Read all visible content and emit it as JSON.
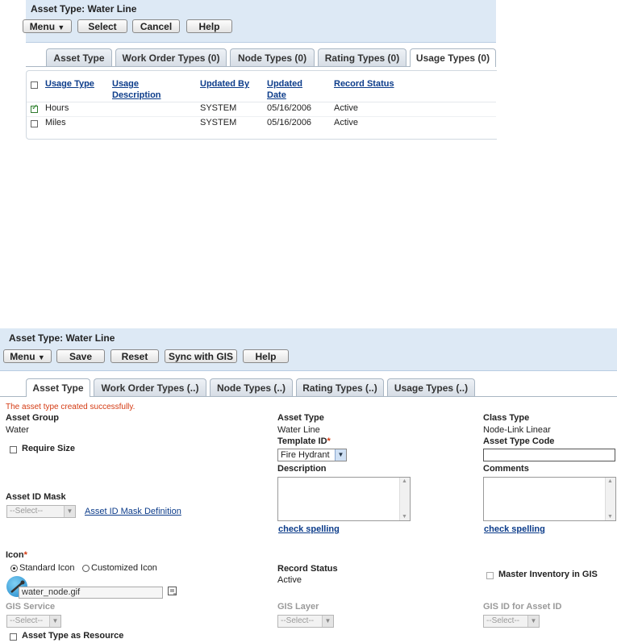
{
  "top": {
    "title": "Asset Type: Water Line",
    "buttons": {
      "menu": "Menu",
      "select": "Select",
      "cancel": "Cancel",
      "help": "Help"
    },
    "tabs": [
      "Asset Type",
      "Work Order Types (0)",
      "Node Types (0)",
      "Rating Types (0)",
      "Usage Types (0)"
    ],
    "active_tab": "Usage Types (0)",
    "table": {
      "headers": [
        "Usage Type",
        "Usage Description",
        "Updated By",
        "Updated Date",
        "Record Status"
      ],
      "header_lines": {
        "usage_desc_1": "Usage",
        "usage_desc_2": "Description",
        "updated_date_1": "Updated",
        "updated_date_2": "Date"
      },
      "rows": [
        {
          "usage_type": "Hours",
          "description": "",
          "updated_by": "SYSTEM",
          "updated_date": "05/16/2006",
          "status": "Active",
          "checked": true
        },
        {
          "usage_type": "Miles",
          "description": "",
          "updated_by": "SYSTEM",
          "updated_date": "05/16/2006",
          "status": "Active",
          "checked": false
        }
      ]
    }
  },
  "bottom": {
    "title": "Asset Type: Water Line",
    "buttons": {
      "menu": "Menu",
      "save": "Save",
      "reset": "Reset",
      "sync": "Sync with GIS",
      "help": "Help"
    },
    "tabs": [
      "Asset Type",
      "Work Order Types (..)",
      "Node Types (..)",
      "Rating Types (..)",
      "Usage Types (..)"
    ],
    "active_tab": "Asset Type",
    "message": "The asset type created successfully.",
    "fields": {
      "asset_group_label": "Asset Group",
      "asset_group_value": "Water",
      "asset_type_label": "Asset Type",
      "asset_type_value": "Water Line",
      "class_type_label": "Class Type",
      "class_type_value": "Node-Link Linear",
      "require_size_label": "Require Size",
      "template_id_label": "Template ID",
      "template_id_value": "Fire Hydrant",
      "asset_type_code_label": "Asset Type Code",
      "asset_type_code_value": "",
      "description_label": "Description",
      "comments_label": "Comments",
      "asset_id_mask_label": "Asset ID Mask",
      "asset_id_mask_value": "--Select--",
      "asset_id_mask_link": "Asset ID Mask Definition",
      "check_spelling": "check spelling",
      "icon_label": "Icon",
      "standard_icon": "Standard Icon",
      "customized_icon": "Customized Icon",
      "icon_file": "water_node.gif",
      "record_status_label": "Record Status",
      "record_status_value": "Active",
      "master_inventory_label": "Master Inventory in GIS",
      "gis_service_label": "GIS Service",
      "gis_layer_label": "GIS Layer",
      "gis_id_label": "GIS ID for Asset ID",
      "select_placeholder": "--Select--",
      "asset_type_resource_label": "Asset Type as Resource",
      "required_mark": "*"
    },
    "colors": {
      "message": "#d43a12",
      "required": "#d43a12",
      "link": "#0c3c8a"
    }
  }
}
